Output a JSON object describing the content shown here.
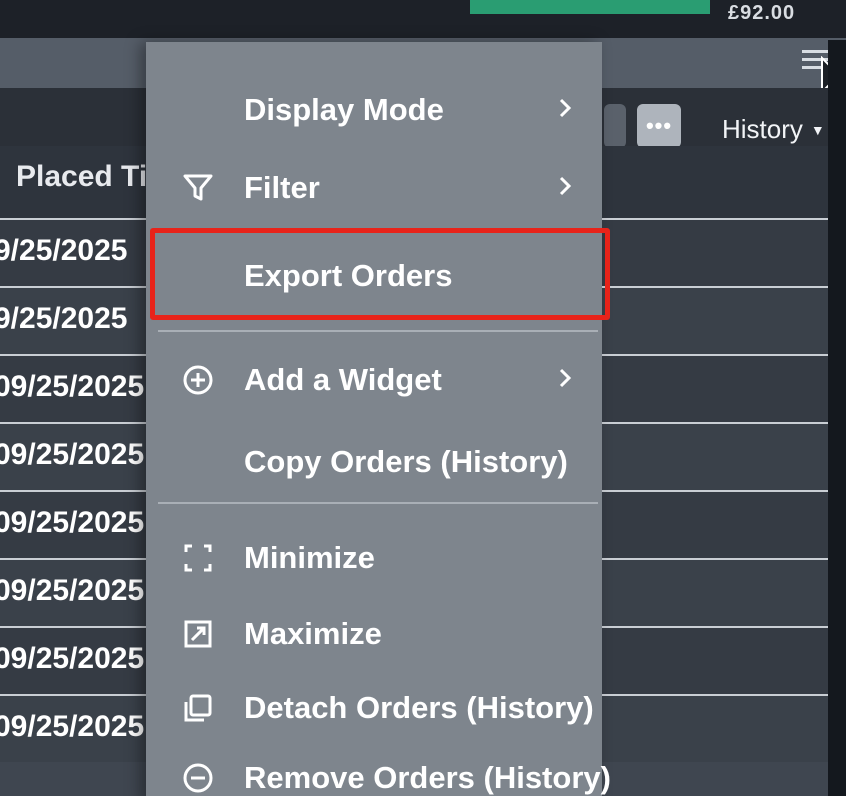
{
  "topbar": {
    "price": "£92.00"
  },
  "toolbar": {
    "history_label": "History",
    "more_label": "•••"
  },
  "table": {
    "column_header": "Placed Ti",
    "rows": [
      "9/25/2025",
      "9/25/2025",
      "09/25/2025",
      "09/25/2025",
      "09/25/2025",
      "09/25/2025",
      "09/25/2025",
      "09/25/2025"
    ]
  },
  "menu": {
    "items": [
      {
        "label": "Display Mode",
        "icon": "none",
        "submenu": true
      },
      {
        "label": "Filter",
        "icon": "filter-icon",
        "submenu": true
      },
      {
        "label": "Export Orders",
        "icon": "none",
        "submenu": false
      },
      {
        "label": "Add a Widget",
        "icon": "plus-circle-icon",
        "submenu": true
      },
      {
        "label": "Copy Orders (History)",
        "icon": "none",
        "submenu": false
      },
      {
        "label": "Minimize",
        "icon": "minimize-icon",
        "submenu": false
      },
      {
        "label": "Maximize",
        "icon": "maximize-icon",
        "submenu": false
      },
      {
        "label": "Detach Orders (History)",
        "icon": "detach-icon",
        "submenu": false
      },
      {
        "label": "Remove Orders (History)",
        "icon": "remove-icon",
        "submenu": false
      }
    ]
  },
  "colors": {
    "highlight": "#e8231a",
    "menu_bg": "#7e858d",
    "accent_green": "#2a9d72"
  }
}
